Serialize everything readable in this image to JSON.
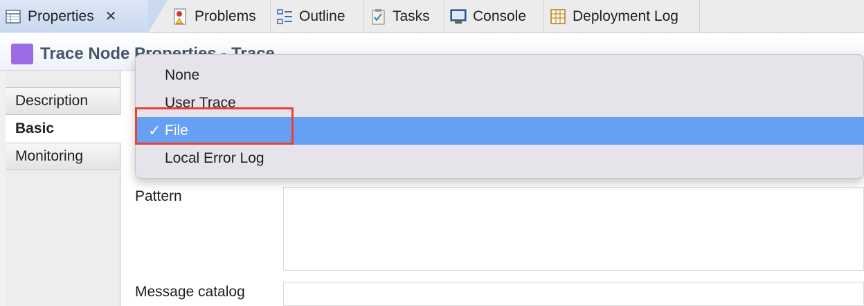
{
  "tabs": [
    {
      "label": "Properties",
      "icon": "properties-icon",
      "active": true
    },
    {
      "label": "Problems",
      "icon": "problems-icon"
    },
    {
      "label": "Outline",
      "icon": "outline-icon"
    },
    {
      "label": "Tasks",
      "icon": "tasks-icon"
    },
    {
      "label": "Console",
      "icon": "console-icon"
    },
    {
      "label": "Deployment Log",
      "icon": "deployment-log-icon"
    }
  ],
  "tab_close_glyph": "✕",
  "header": {
    "title": "Trace Node Properties - Trace"
  },
  "nav": {
    "items": [
      {
        "label": "Description"
      },
      {
        "label": "Basic",
        "selected": true
      },
      {
        "label": "Monitoring"
      }
    ]
  },
  "form": {
    "pattern_label": "Pattern",
    "pattern_value": "",
    "message_catalog_label": "Message catalog",
    "message_catalog_value": ""
  },
  "destination_menu": {
    "options": [
      {
        "label": "None"
      },
      {
        "label": "User Trace"
      },
      {
        "label": "File",
        "selected": true
      },
      {
        "label": "Local Error Log"
      }
    ],
    "check_glyph": "✓",
    "selected_color": "#66a0f5"
  },
  "colors": {
    "annotation_box": "#e8412f",
    "node_icon": "#9b6ae6",
    "header_text": "#46566a"
  }
}
